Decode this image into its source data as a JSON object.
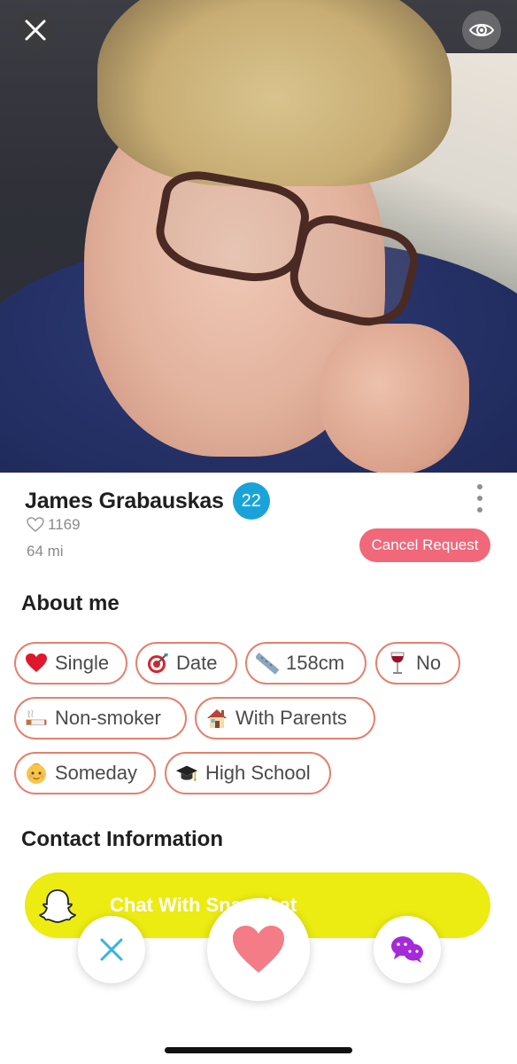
{
  "profile": {
    "name": "James Grabauskas",
    "age": "22",
    "likes": "1169",
    "distance": "64 mi",
    "cancel_label": "Cancel Request"
  },
  "about": {
    "title": "About me",
    "tags": [
      {
        "label": "Single",
        "icon": "heart-icon"
      },
      {
        "label": "Date",
        "icon": "target-icon"
      },
      {
        "label": "158cm",
        "icon": "ruler-icon"
      },
      {
        "label": "No",
        "icon": "wine-glass-icon"
      },
      {
        "label": "Non-smoker",
        "icon": "cigarette-icon"
      },
      {
        "label": "With Parents",
        "icon": "house-icon"
      },
      {
        "label": "Someday",
        "icon": "baby-icon"
      },
      {
        "label": "High School",
        "icon": "graduation-cap-icon"
      }
    ]
  },
  "contact": {
    "title": "Contact Information",
    "snapchat_label": "Chat With SnapChat"
  },
  "colors": {
    "age_badge": "#1aa3d9",
    "cancel_button": "#f0687a",
    "chip_border": "#e5806e",
    "snapchat_yellow": "#eceb12",
    "like_heart": "#f47c86",
    "pass_x": "#38b3e0",
    "chat_purple": "#a42bd8"
  }
}
